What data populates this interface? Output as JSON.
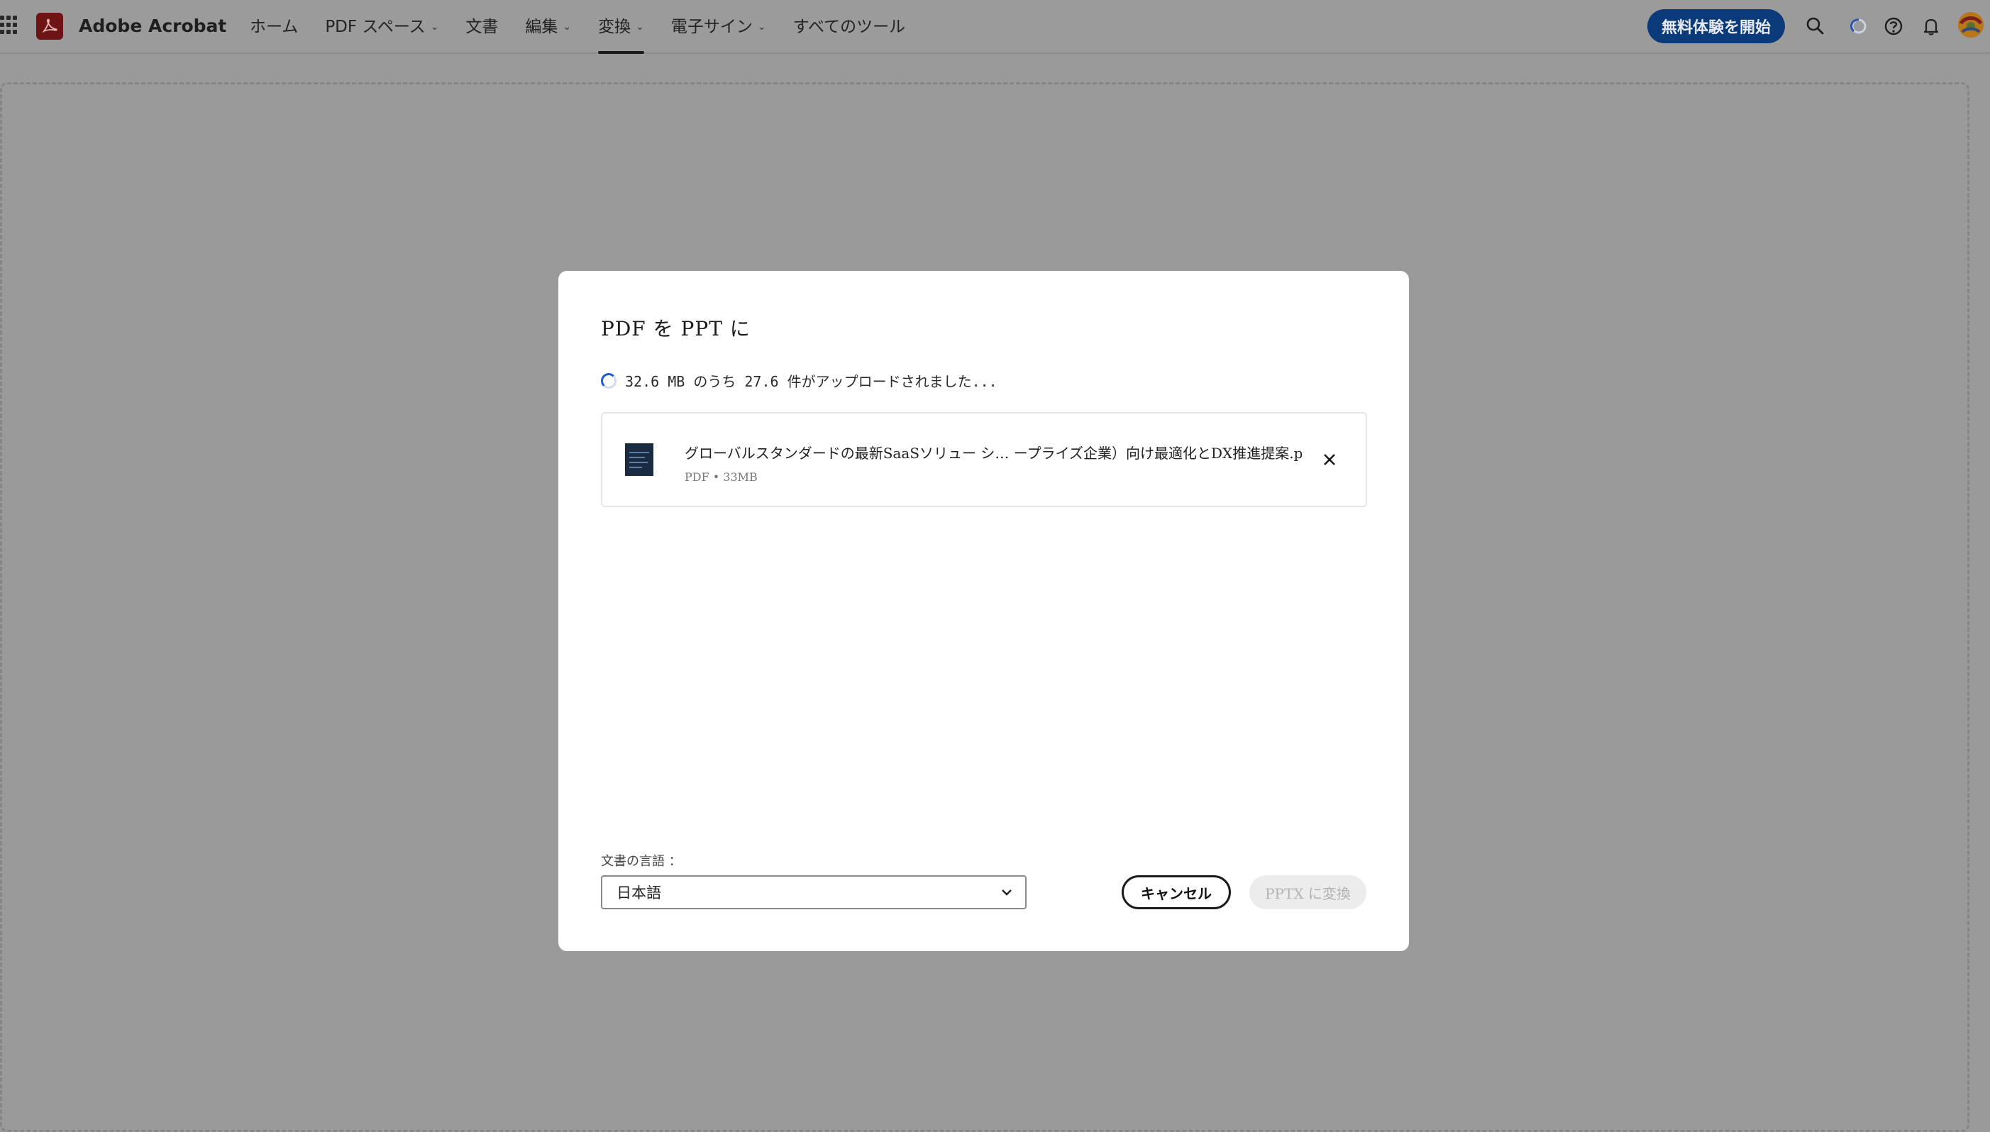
{
  "app": {
    "brand": "Adobe Acrobat"
  },
  "nav": {
    "items": [
      {
        "label": "ホーム",
        "has_dropdown": false,
        "active": false
      },
      {
        "label": "PDF スペース",
        "has_dropdown": true,
        "active": false
      },
      {
        "label": "文書",
        "has_dropdown": false,
        "active": false
      },
      {
        "label": "編集",
        "has_dropdown": true,
        "active": false
      },
      {
        "label": "変換",
        "has_dropdown": true,
        "active": true
      },
      {
        "label": "電子サイン",
        "has_dropdown": true,
        "active": false
      },
      {
        "label": "すべてのツール",
        "has_dropdown": false,
        "active": false
      }
    ]
  },
  "header": {
    "trial_button": "無料体験を開始",
    "icons": [
      "search-icon",
      "loading-icon",
      "help-icon",
      "bell-icon",
      "avatar"
    ]
  },
  "dialog": {
    "title": "PDF を PPT に",
    "status": "32.6 MB のうち 27.6 件がアップロードされました...",
    "file": {
      "name": "グローバルスタンダードの最新SaaSソリュー シ… ープライズ企業）向け最適化とDX推進提案.pptx",
      "meta": "PDF • 33MB"
    },
    "language_label": "文書の言語 ：",
    "language_value": "日本語",
    "cancel_label": "キャンセル",
    "convert_label": "PPTX に変換"
  },
  "colors": {
    "brand_red": "#6f1414",
    "trial_button": "#0a3a7a",
    "spinner": "#1e5ad6",
    "overlay": "#9a9a9a"
  }
}
